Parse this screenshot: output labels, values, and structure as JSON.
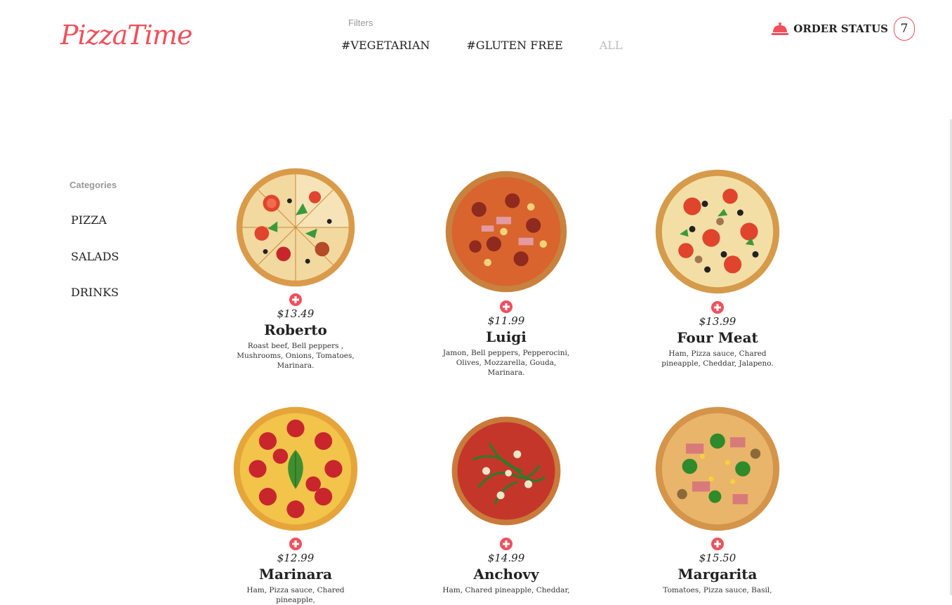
{
  "header": {
    "logo": "PizzaTime",
    "filters_label": "Filters",
    "filters": [
      "#VEGETARIAN",
      "#GLUTEN FREE",
      "ALL"
    ],
    "order_status_label": "ORDER STATUS",
    "order_count": "7",
    "bell_icon": "service-bell-icon"
  },
  "sidebar": {
    "categories_label": "Categories",
    "items": [
      "PIZZA",
      "SALADS",
      "DRINKS"
    ]
  },
  "colors": {
    "accent": "#f0505c"
  },
  "products": [
    {
      "price": "$13.49",
      "name": "Roberto",
      "ingredients": "Roast beef, Bell peppers , Mushrooms, Onions, Tomatoes, Marinara."
    },
    {
      "price": "$11.99",
      "name": "Luigi",
      "ingredients": "Jamon, Bell peppers, Pepperocini, Olives, Mozzarella, Gouda, Marinara."
    },
    {
      "price": "$13.99",
      "name": "Four Meat",
      "ingredients": "Ham, Pizza sauce, Chared pineapple, Cheddar, Jalapeno."
    },
    {
      "price": "$12.99",
      "name": "Marinara",
      "ingredients": "Ham, Pizza sauce, Chared pineapple,"
    },
    {
      "price": "$14.99",
      "name": "Anchovy",
      "ingredients": "Ham, Chared pineapple, Cheddar,"
    },
    {
      "price": "$15.50",
      "name": "Margarita",
      "ingredients": "Tomatoes, Pizza sauce, Basil,"
    }
  ]
}
